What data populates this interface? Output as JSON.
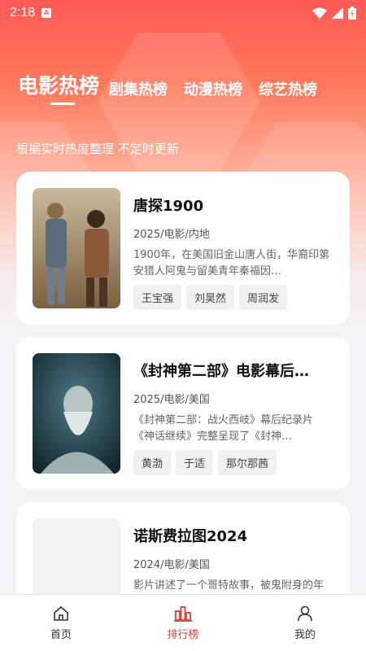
{
  "status_bar": {
    "time": "2:18"
  },
  "tabs": [
    {
      "label": "电影热榜",
      "active": true
    },
    {
      "label": "剧集热榜",
      "active": false
    },
    {
      "label": "动漫热榜",
      "active": false
    },
    {
      "label": "综艺热榜",
      "active": false
    }
  ],
  "subtitle": "根据实时热度整理 不定时更新",
  "items": [
    {
      "title": "唐探1900",
      "meta": "2025/电影/内地",
      "desc": "1900年，在美国旧金山唐人街，华裔印第安猎人阿鬼与留美青年秦福因…",
      "tags": [
        "王宝强",
        "刘昊然",
        "周润发"
      ]
    },
    {
      "title": "《封神第二部》电影幕后…",
      "meta": "2025/电影/美国",
      "desc": "《封神第二部：战火西岐》幕后纪录片《神话继续》完整呈现了《封神…",
      "tags": [
        "黄渤",
        "于适",
        "那尔那茜"
      ]
    },
    {
      "title": "诺斯费拉图2024",
      "meta": "2024/电影/美国",
      "desc": "影片讲述了一个哥特故事，被鬼附身的年轻女子艾伦·赫特（莉莉-罗丝",
      "tags": []
    }
  ],
  "bottom_nav": [
    {
      "label": "首页",
      "icon": "home-icon",
      "active": false
    },
    {
      "label": "排行榜",
      "icon": "chart-icon",
      "active": true
    },
    {
      "label": "我的",
      "icon": "user-icon",
      "active": false
    }
  ],
  "colors": {
    "accent": "#e43c3c",
    "header_top": "#ff5a55"
  }
}
